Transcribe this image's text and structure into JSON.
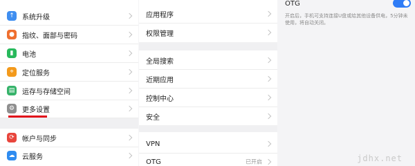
{
  "left_menu": {
    "items": [
      {
        "label": "系统升级",
        "icon": "system-update-icon",
        "color": "#3f8ef0"
      },
      {
        "label": "指纹、面部与密码",
        "icon": "fingerprint-icon",
        "color": "#ef6f2f"
      },
      {
        "label": "电池",
        "icon": "battery-icon",
        "color": "#28b95c"
      },
      {
        "label": "定位服务",
        "icon": "location-icon",
        "color": "#f39a1c"
      },
      {
        "label": "运存与存储空间",
        "icon": "storage-icon",
        "color": "#36b36a"
      },
      {
        "label": "更多设置",
        "icon": "more-settings-icon",
        "color": "#8f8f8f"
      },
      {
        "label": "帐户与同步",
        "icon": "account-sync-icon",
        "color": "#e8453c"
      },
      {
        "label": "云服务",
        "icon": "cloud-service-icon",
        "color": "#2f8cf0"
      }
    ],
    "selected_index": 5,
    "selected_underline_color": "#e10b1a"
  },
  "middle_menu": {
    "items": [
      {
        "label": "应用程序"
      },
      {
        "label": "权限管理"
      },
      {
        "label": "全局搜索"
      },
      {
        "label": "近期应用"
      },
      {
        "label": "控制中心"
      },
      {
        "label": "安全"
      },
      {
        "label": "VPN"
      },
      {
        "label": "OTG",
        "value": "已开启"
      }
    ]
  },
  "otg_panel": {
    "title": "OTG",
    "toggle_on": true,
    "toggle_color": "#2f7cf6",
    "description": "开启后，手机可支持连接U盘或给其他设备供电，5分钟未使用，将自动关闭。"
  },
  "watermark": "jdhx.net"
}
